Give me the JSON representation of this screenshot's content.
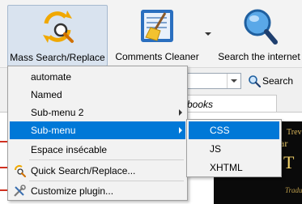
{
  "toolbar": {
    "buttons": [
      {
        "label": "Mass Search/Replace",
        "icon": "search-replace-icon",
        "state": "pressed"
      },
      {
        "label": "Comments Cleaner",
        "icon": "broom-document-icon"
      },
      {
        "label": "Search the internet",
        "icon": "magnifier-globe-icon"
      }
    ]
  },
  "search": {
    "button_label": "Search",
    "combo_value": ""
  },
  "editor": {
    "tab_label": "books"
  },
  "preview": {
    "line1": "Trev",
    "line2": "ar",
    "line3": "T",
    "line4": "Traduct"
  },
  "menu": {
    "items": [
      {
        "label": "automate"
      },
      {
        "label": "Named"
      },
      {
        "label": "Sub-menu 2",
        "has_submenu": true
      },
      {
        "label": "Sub-menu",
        "has_submenu": true,
        "highlighted": true
      },
      {
        "label": "Espace insécable"
      },
      {
        "label": "Quick Search/Replace...",
        "icon": "quick-search-icon",
        "mnemonic": "Q"
      },
      {
        "label": "Customize plugin...",
        "icon": "tools-icon",
        "mnemonic": "C"
      }
    ]
  },
  "submenu": {
    "items": [
      {
        "label": "CSS",
        "highlighted": true
      },
      {
        "label": "JS"
      },
      {
        "label": "XHTML"
      }
    ]
  },
  "colors": {
    "highlight": "#0078d7",
    "pressed_button": "#d9e3ef"
  }
}
